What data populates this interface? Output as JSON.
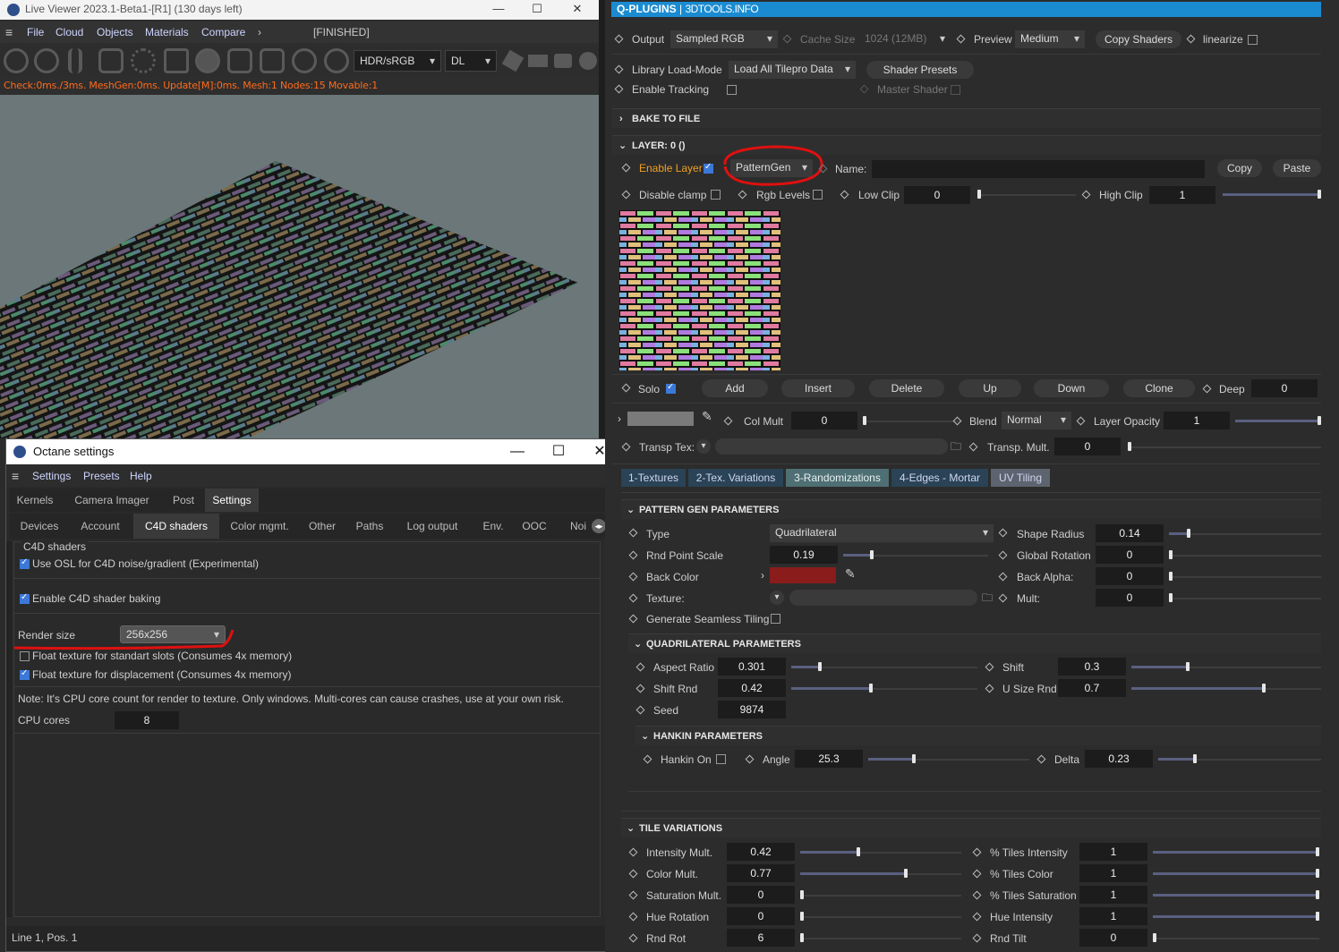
{
  "live_viewer": {
    "title": "Live Viewer 2023.1-Beta1-[R1] (130 days left)",
    "menu": [
      "File",
      "Cloud",
      "Objects",
      "Materials",
      "Compare"
    ],
    "status": "[FINISHED]",
    "color_mode": "HDR/sRGB",
    "kernel": "DL",
    "stats": "Check:0ms./3ms. MeshGen:0ms. Update[M]:0ms. Mesh:1 Nodes:15 Movable:1"
  },
  "octane_settings": {
    "title": "Octane settings",
    "menu": [
      "Settings",
      "Presets",
      "Help"
    ],
    "tabs1": [
      "Kernels",
      "Camera Imager",
      "Post",
      "Settings"
    ],
    "tabs2": [
      "Devices",
      "Account",
      "C4D shaders",
      "Color mgmt.",
      "Other",
      "Paths",
      "Log output",
      "Env.",
      "OOC",
      "Noi"
    ],
    "group": "C4D shaders",
    "use_osl": "Use OSL for C4D noise/gradient (Experimental)",
    "enable_baking": "Enable C4D shader baking",
    "render_size_label": "Render size",
    "render_size": "256x256",
    "float_std": "Float texture for standart slots (Consumes 4x memory)",
    "float_disp": "Float texture for displacement (Consumes 4x memory)",
    "note": "Note: It's CPU core count for render to texture. Only windows. Multi-cores can cause crashes, use at your own risk.",
    "cpu_label": "CPU cores",
    "cpu_value": "8",
    "statusbar": "Line 1, Pos. 1"
  },
  "qp": {
    "brand": "Q-PLUGINS",
    "brand2": "3DTOOLS.INFO",
    "output_label": "Output",
    "output": "Sampled RGB",
    "cache_label": "Cache Size",
    "cache": "1024 (12MB)",
    "preview_label": "Preview",
    "preview": "Medium",
    "copy_shaders": "Copy Shaders",
    "linearize": "linearize",
    "lib_label": "Library Load-Mode",
    "lib": "Load All Tilepro Data",
    "shader_presets": "Shader Presets",
    "tracking": "Enable Tracking",
    "master": "Master Shader",
    "bake": "BAKE TO FILE",
    "layer": "LAYER: 0 ()",
    "enable_layer": "Enable Layer",
    "layer_type": "PatternGen",
    "name_label": "Name:",
    "copy": "Copy",
    "paste": "Paste",
    "disable_clamp": "Disable clamp",
    "rgb_levels": "Rgb Levels",
    "low_clip": "Low Clip",
    "low_clip_v": "0",
    "high_clip": "High Clip",
    "high_clip_v": "1",
    "solo": "Solo",
    "layer_btns": [
      "Add",
      "Insert",
      "Delete",
      "Up",
      "Down",
      "Clone"
    ],
    "deep": "Deep",
    "deep_v": "0",
    "col_mult": "Col Mult",
    "col_mult_v": "0",
    "blend": "Blend",
    "blend_v": "Normal",
    "opacity": "Layer Opacity",
    "opacity_v": "1",
    "transp_tex": "Transp Tex:",
    "transp_mult": "Transp. Mult.",
    "transp_mult_v": "0",
    "ctabs": [
      "1-Textures",
      "2-Tex. Variations",
      "3-Randomizations",
      "4-Edges - Mortar",
      "UV Tiling"
    ],
    "pg_hdr": "PATTERN GEN PARAMETERS",
    "type": "Type",
    "type_v": "Quadrilateral",
    "shape_radius": "Shape Radius",
    "shape_radius_v": "0.14",
    "rnd_point": "Rnd Point Scale",
    "rnd_point_v": "0.19",
    "global_rot": "Global Rotation",
    "global_rot_v": "0",
    "back_color": "Back Color",
    "back_alpha": "Back Alpha:",
    "back_alpha_v": "0",
    "texture": "Texture:",
    "mult": "Mult:",
    "mult_v": "0",
    "seamless": "Generate Seamless Tiling",
    "quad_hdr": "QUADRILATERAL PARAMETERS",
    "aspect": "Aspect Ratio",
    "aspect_v": "0.301",
    "shift": "Shift",
    "shift_v": "0.3",
    "shift_rnd": "Shift Rnd",
    "shift_rnd_v": "0.42",
    "usize": "U Size Rnd",
    "usize_v": "0.7",
    "seed": "Seed",
    "seed_v": "9874",
    "hankin_hdr": "HANKIN PARAMETERS",
    "hankin_on": "Hankin On",
    "angle": "Angle",
    "angle_v": "25.3",
    "delta": "Delta",
    "delta_v": "0.23",
    "tv_hdr": "TILE VARIATIONS",
    "tv_left": [
      [
        "Intensity Mult.",
        "0.42"
      ],
      [
        "Color Mult.",
        "0.77"
      ],
      [
        "Saturation Mult.",
        "0"
      ],
      [
        "Hue Rotation",
        "0"
      ],
      [
        "Rnd Rot",
        "6"
      ]
    ],
    "tv_right": [
      [
        "% Tiles Intensity",
        "1"
      ],
      [
        "% Tiles Color",
        "1"
      ],
      [
        "% Tiles Saturation",
        "1"
      ],
      [
        "Hue Intensity",
        "1"
      ],
      [
        "Rnd Tilt",
        "0"
      ]
    ]
  },
  "colors": {
    "accent": "#1a8bd1",
    "annotation": "#e01010",
    "back_color": "#8a1c1c",
    "checkbox": "#3b78d8"
  }
}
